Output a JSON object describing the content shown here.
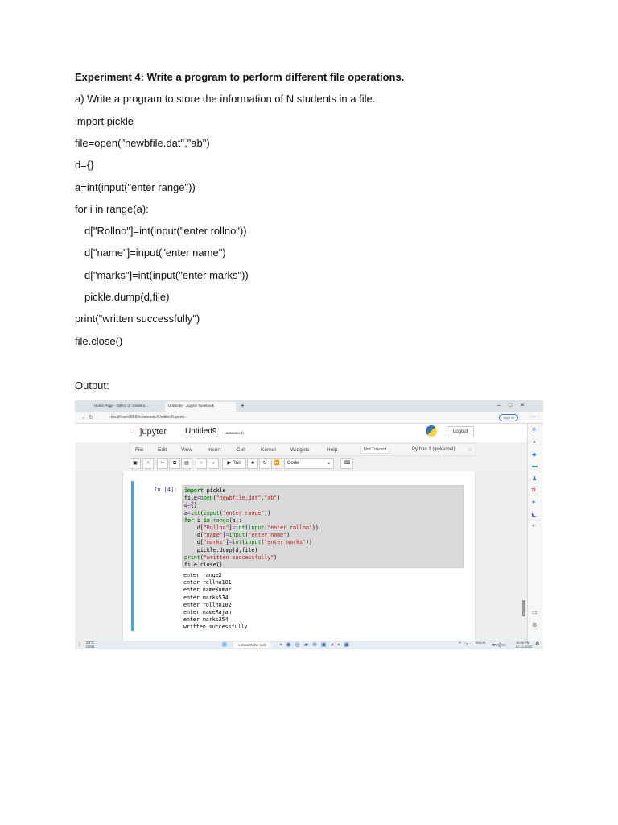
{
  "document": {
    "heading": "Experiment 4: Write a program to perform different file operations.",
    "subheading": "a) Write a program to store the information of N students in a file.",
    "code_lines": [
      "import pickle",
      "file=open(\"newbfile.dat\",\"ab\")",
      "d={}",
      "a=int(input(\"enter range\"))",
      "for i in range(a):",
      "d[\"Rollno\"]=int(input(\"enter rollno\"))",
      "d[\"name\"]=input(\"enter name\")",
      "d[\"marks\"]=int(input(\"enter marks\"))",
      "pickle.dump(d,file)",
      "print(\"written successfully\")",
      "file.close()"
    ],
    "output_label": "Output:"
  },
  "screenshot": {
    "tabs": [
      "Home Page - Select or create a ...",
      "Untitled9 - Jupyter Notebook"
    ],
    "url": "localhost:8888/notebooks/Untitled9.ipynb",
    "sign_in": "Sign in",
    "logo": "jupyter",
    "notebook_title": "Untitled9",
    "autosave": "(autosaved)",
    "logout": "Logout",
    "menu": [
      "File",
      "Edit",
      "View",
      "Insert",
      "Cell",
      "Kernel",
      "Widgets",
      "Help"
    ],
    "trust": "Not Trusted",
    "kernel": "Python 3 (ipykernel)",
    "run": "Run",
    "cell_type": "Code",
    "prompt": "In [4]:",
    "output": [
      "enter range2",
      "enter rollno101",
      "enter nameKumar",
      "enter marks534",
      "enter rollno102",
      "enter nameRajan",
      "enter marks354",
      "written successfully"
    ],
    "weather": {
      "temp": "23°C",
      "cond": "Clear"
    },
    "search": "Search the web",
    "lang": "ENG IN",
    "time": "10:05 PM",
    "date": "01-11-2022"
  }
}
